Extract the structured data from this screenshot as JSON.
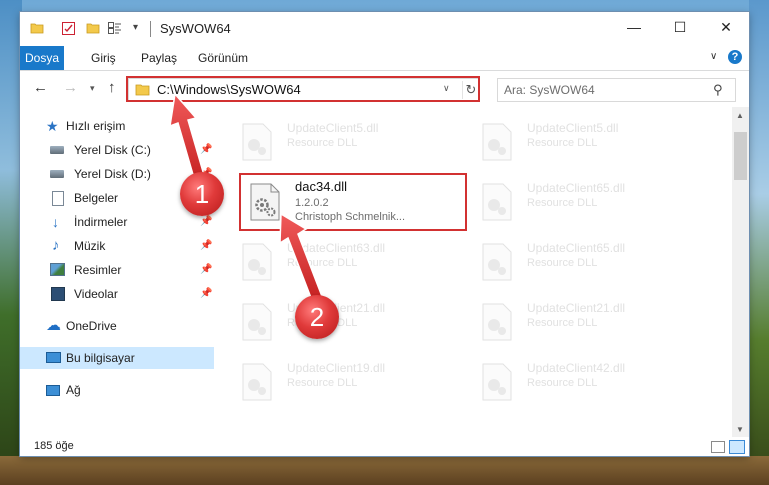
{
  "window": {
    "title": "SysWOW64"
  },
  "controls": {
    "minimize": "—",
    "maximize": "☐",
    "close": "✕"
  },
  "ribbon": {
    "tabs": [
      "Dosya",
      "Giriş",
      "Paylaş",
      "Görünüm"
    ],
    "help": "?"
  },
  "navigation": {
    "address": "C:\\Windows\\SysWOW64",
    "search_placeholder": "Ara: SysWOW64"
  },
  "sidebar": {
    "items": [
      {
        "label": "Hızlı erişim",
        "icon": "star-icon"
      },
      {
        "label": "Yerel Disk (C:)",
        "icon": "disk-icon",
        "pinned": true
      },
      {
        "label": "Yerel Disk (D:)",
        "icon": "disk-icon",
        "pinned": true
      },
      {
        "label": "Belgeler",
        "icon": "document-icon",
        "pinned": true
      },
      {
        "label": "İndirmeler",
        "icon": "download-icon",
        "pinned": true
      },
      {
        "label": "Müzik",
        "icon": "music-icon",
        "pinned": true
      },
      {
        "label": "Resimler",
        "icon": "pictures-icon",
        "pinned": true
      },
      {
        "label": "Videolar",
        "icon": "video-icon",
        "pinned": true
      },
      {
        "label": "OneDrive",
        "icon": "cloud-icon"
      },
      {
        "label": "Bu bilgisayar",
        "icon": "computer-icon",
        "selected": true
      },
      {
        "label": "Ağ",
        "icon": "network-icon"
      }
    ]
  },
  "files": {
    "focused": {
      "name": "dac34.dll",
      "version": "1.2.0.2",
      "company": "Christoph Schmelnik..."
    },
    "tiles": [
      {
        "name": "UpdateClient5.dll",
        "sub": "Resource DLL"
      },
      {
        "name": "UpdateClient5.dll",
        "sub": "Resource DLL"
      },
      {
        "name": "UpdateClient65.dll",
        "sub": "Resource DLL"
      },
      {
        "name": "UpdateClient63.dll",
        "sub": "Resource DLL"
      },
      {
        "name": "UpdateClient65.dll",
        "sub": "Resource DLL"
      },
      {
        "name": "UpdateClient21.dll",
        "sub": "Resource DLL"
      },
      {
        "name": "UpdateClient21.dll",
        "sub": "Resource DLL"
      },
      {
        "name": "UpdateClient19.dll",
        "sub": "Resource DLL"
      },
      {
        "name": "UpdateClient42.dll",
        "sub": "Resource DLL"
      }
    ]
  },
  "status": {
    "count": "185 öğe"
  },
  "annotations": {
    "callout1": "1",
    "callout2": "2"
  },
  "colors": {
    "accent": "#1979ca",
    "highlight": "#d23131",
    "selection": "#cce8ff"
  }
}
